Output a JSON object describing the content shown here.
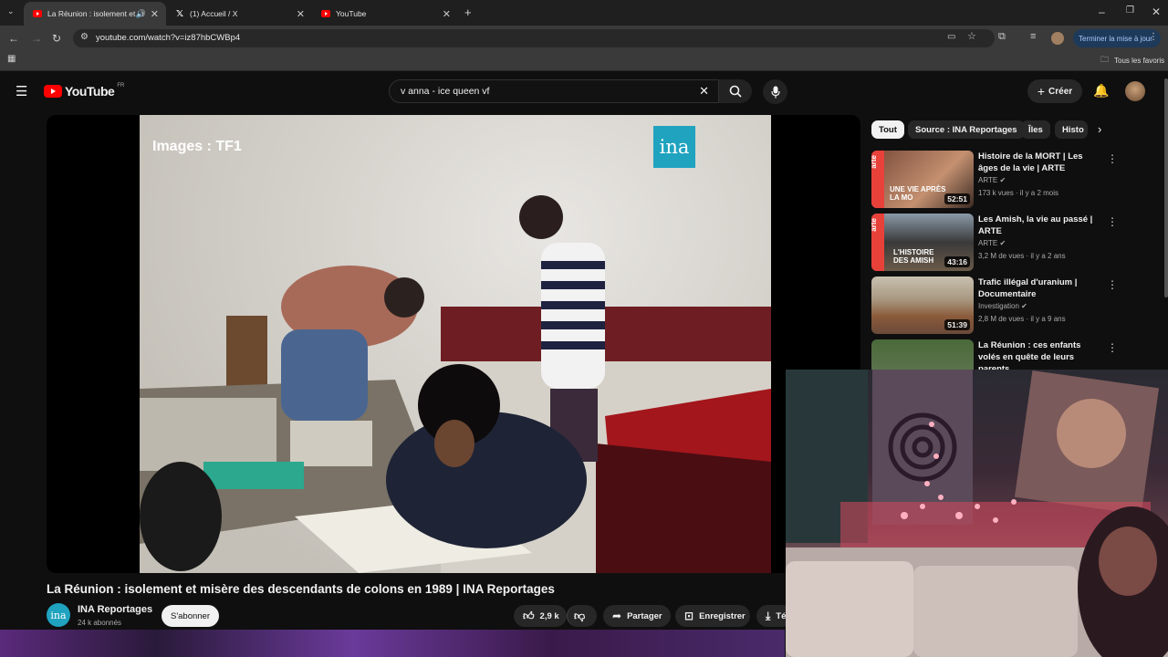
{
  "browser": {
    "tabs": [
      {
        "title": "La Réunion : isolement et m",
        "active": true
      },
      {
        "title": "(1) Accueil / X",
        "active": false
      },
      {
        "title": "YouTube",
        "active": false
      }
    ],
    "url": "youtube.com/watch?v=iz87hbCWBp4",
    "update_button": "Terminer la mise à jour",
    "bookmarks_label": "Tous les favoris"
  },
  "youtube": {
    "logo_text": "YouTube",
    "region": "FR",
    "search_query": "v anna - ice queen vf",
    "create_label": "Créer"
  },
  "video": {
    "watermark": "Images : TF1",
    "logo": "ina",
    "title": "La Réunion : isolement et misère des descendants de colons en 1989 | INA Reportages",
    "channel": "INA Reportages",
    "subscribers": "24 k abonnés",
    "subscribe_label": "S'abonner",
    "likes": "2,9 k",
    "share_label": "Partager",
    "save_label": "Enregistrer",
    "download_label": "Té"
  },
  "chips": [
    "Tout",
    "Source : INA Reportages",
    "Îles",
    "Histo"
  ],
  "recommendations": [
    {
      "title": "Histoire de la MORT | Les âges de la vie | ARTE",
      "channel": "ARTE",
      "meta": "173 k vues · il y a 2 mois",
      "duration": "52:51",
      "thumb_text": "UNE VIE APRÈS LA MO",
      "thumb_brand": "arte"
    },
    {
      "title": "Les Amish, la vie au passé | ARTE",
      "channel": "ARTE",
      "meta": "3,2 M de vues · il y a 2 ans",
      "duration": "43:16",
      "thumb_text": "L'HISTOIRE DES AMISH",
      "thumb_brand": "arte"
    },
    {
      "title": "Trafic illégal d'uranium | Documentaire",
      "channel": "Investigation",
      "meta": "2,8 M de vues · il y a 9 ans",
      "duration": "51:39",
      "thumb_text": "",
      "thumb_brand": ""
    },
    {
      "title": "La Réunion : ces enfants volés en quête de leurs parents",
      "channel": "",
      "meta": "",
      "duration": "",
      "thumb_text": "",
      "thumb_brand": ""
    }
  ]
}
